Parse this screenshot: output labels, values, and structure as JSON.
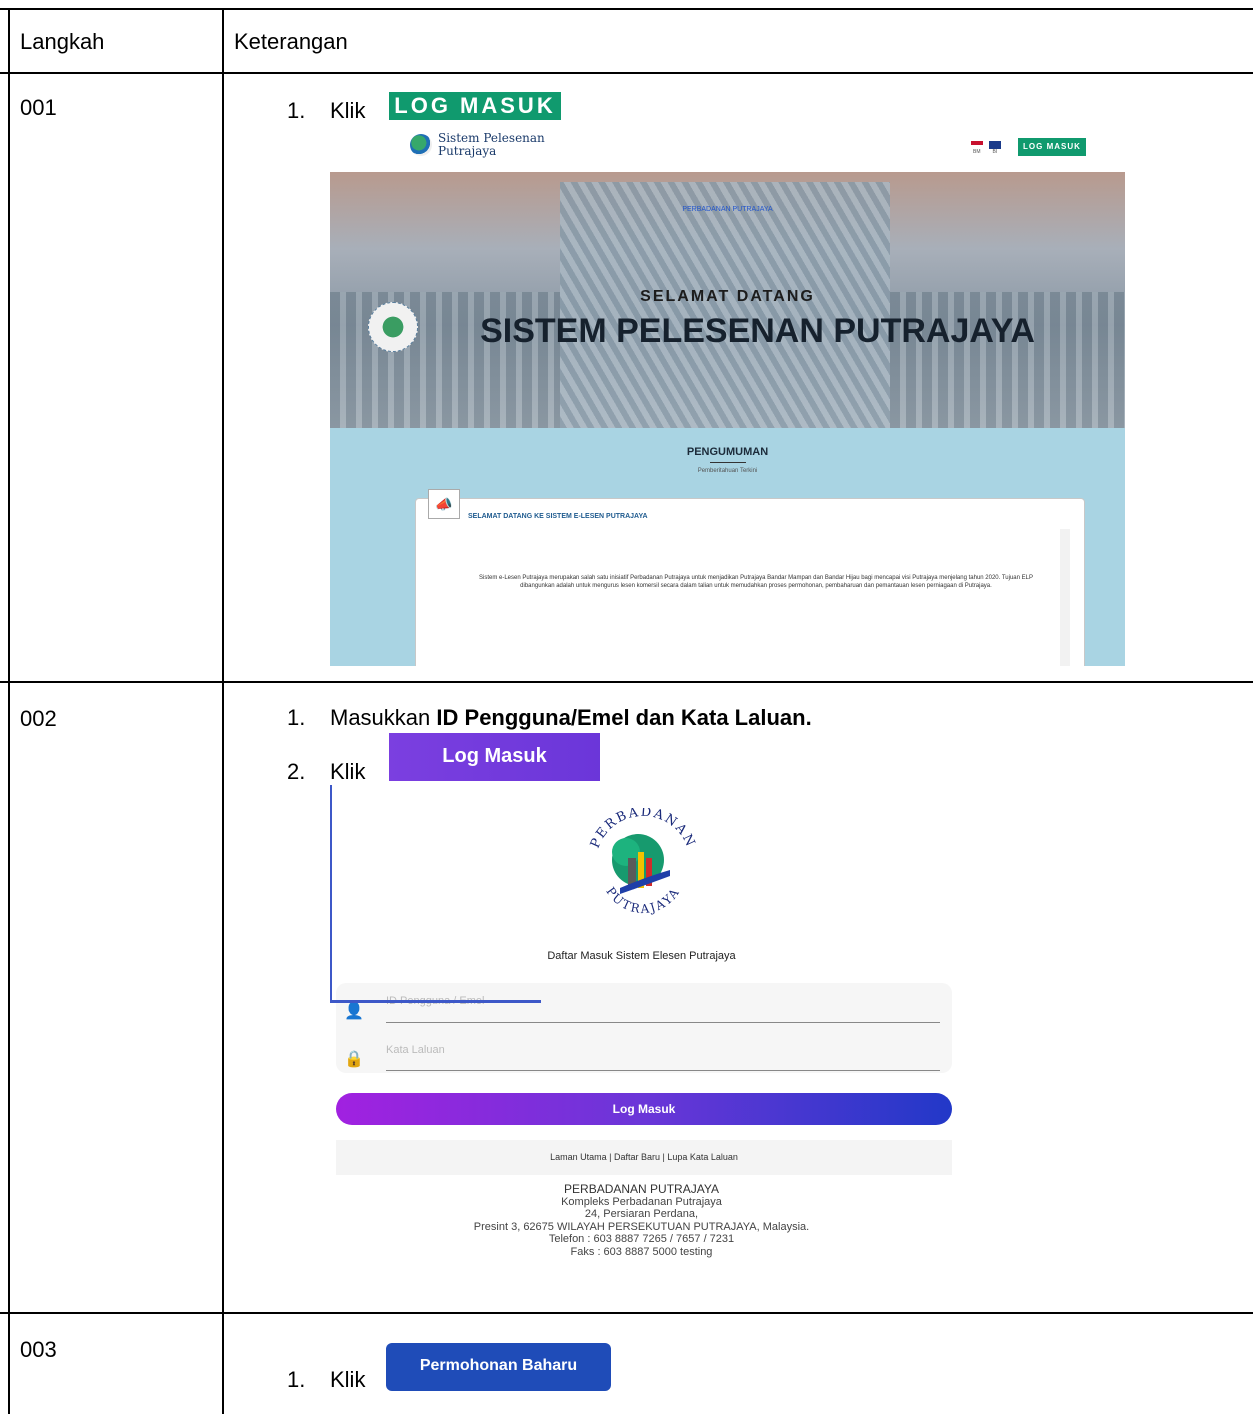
{
  "table": {
    "header_step": "Langkah",
    "header_desc": "Keterangan"
  },
  "rows": [
    {
      "step": "001",
      "instructions": [
        {
          "num": "1.",
          "text": "Klik",
          "button": "LOG MASUK"
        }
      ],
      "screenshot": {
        "brand_line1": "Sistem Pelesenan",
        "brand_line2": "Putrajaya",
        "lang_bm": "BM",
        "lang_bi": "BI",
        "login_button": "LOG MASUK",
        "hero_link": "PERBADANAN PUTRAJAYA",
        "welcome": "SELAMAT DATANG",
        "title": "SISTEM PELESENAN PUTRAJAYA",
        "announcement_title": "PENGUMUMAN",
        "announcement_subtitle": "Pemberitahuan Terkini",
        "card_heading": "SELAMAT DATANG KE SISTEM E-LESEN PUTRAJAYA",
        "card_body": "Sistem e-Lesen Putrajaya merupakan salah satu inisiatif Perbadanan Putrajaya untuk menjadikan Putrajaya Bandar Mampan dan Bandar Hijau bagi mencapai visi Putrajaya menjelang tahun 2020. Tujuan ELP dibangunkan adalah untuk mengurus lesen komersil secara dalam talian untuk memudahkan proses permohonan, pembaharuan dan pemantauan lesen perniagaan di Putrajaya."
      }
    },
    {
      "step": "002",
      "instructions": [
        {
          "num": "1.",
          "text": "Masukkan",
          "bold": "ID Pengguna/Emel dan Kata Laluan."
        },
        {
          "num": "2.",
          "text": "Klik",
          "button": "Log Masuk"
        }
      ],
      "screenshot": {
        "logo_top": "PERBADANAN",
        "logo_bottom": "PUTRAJAYA",
        "login_title": "Daftar Masuk Sistem Elesen Putrajaya",
        "username_placeholder": "ID Pengguna / Emel",
        "password_placeholder": "Kata Laluan",
        "login_button": "Log Masuk",
        "links": "Laman Utama | Daftar Baru | Lupa Kata Laluan",
        "address": [
          "PERBADANAN PUTRAJAYA",
          "Kompleks Perbadanan Putrajaya",
          "24, Persiaran Perdana,",
          "Presint 3, 62675 WILAYAH PERSEKUTUAN PUTRAJAYA, Malaysia.",
          "Telefon : 603 8887 7265 / 7657 / 7231",
          "Faks : 603 8887 5000 testing"
        ]
      }
    },
    {
      "step": "003",
      "instructions": [
        {
          "num": "1.",
          "text": "Klik",
          "button": "Permohonan Baharu"
        }
      ]
    }
  ],
  "colors": {
    "green_button": "#109a6e",
    "purple_button": "#7b3fe0",
    "blue_button": "#1f4cb8",
    "announce_bg": "#a9d4e3"
  }
}
